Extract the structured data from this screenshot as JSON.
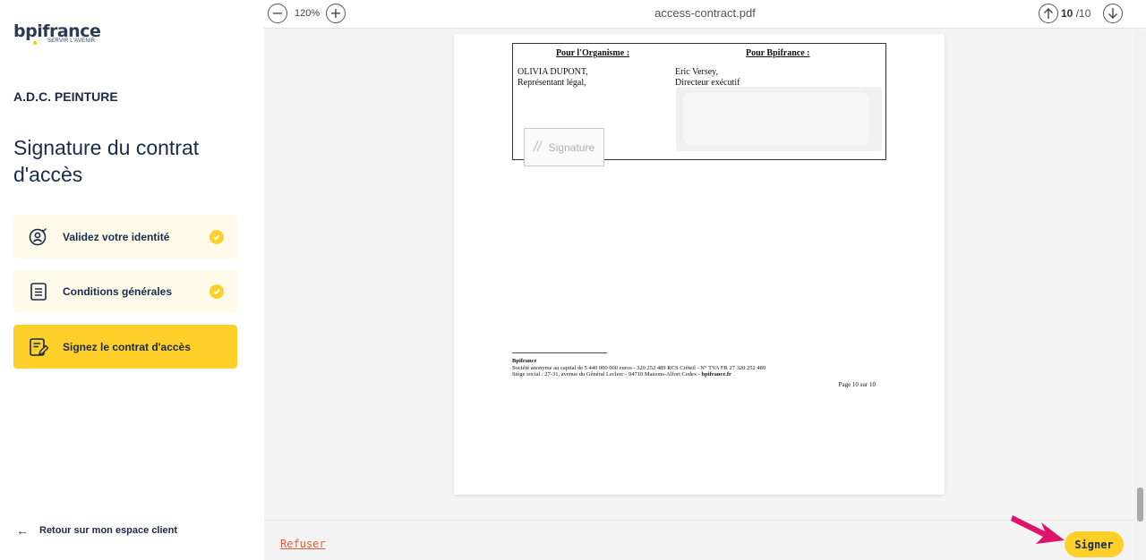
{
  "sidebar": {
    "logo_text": "bpifrance",
    "logo_tagline": "SERVIR L'AVENIR",
    "company_name": "A.D.C. PEINTURE",
    "page_title": "Signature du contrat d'accès",
    "steps": [
      {
        "label": "Validez votre identité",
        "icon": "user-check-icon",
        "completed": true
      },
      {
        "label": "Conditions générales",
        "icon": "document-list-icon",
        "completed": true
      },
      {
        "label": "Signez le contrat d'accès",
        "icon": "document-sign-icon",
        "completed": false,
        "active": true
      }
    ],
    "back_link": "Retour sur mon espace client"
  },
  "viewer": {
    "zoom": "120%",
    "filename": "access-contract.pdf",
    "current_page": "10",
    "total_pages": "/10",
    "document": {
      "left_header": "Pour l'Organisme :",
      "right_header": "Pour Bpifrance :",
      "left_name": "OLIVIA DUPONT,",
      "left_role": "Représentant légal,",
      "right_name": "Eric Versey,",
      "right_role": "Directeur exécutif",
      "signature_field": "Signature",
      "footer_company": "Bpifrance",
      "footer_line1": "Société anonyme au capital de 5 440 000 000 euros - 320 252 489 RCS Créteil - N° TVA FR 27 320 252 489",
      "footer_line2": "Siège social : 27-31, avenue du Général Leclerc - 94710 Maisons-Alfort Cedex - ",
      "footer_website": "bpifrance.fr",
      "page_footer": "Page 10 sur 10"
    },
    "refuse_label": "Refuser",
    "sign_label": "Signer"
  },
  "colors": {
    "brand_navy": "#1a2a4a",
    "brand_yellow": "#ffd02a",
    "step_bg": "#fffbea",
    "refuse_red": "#e05a3a",
    "pointer_magenta": "#e0136b"
  }
}
